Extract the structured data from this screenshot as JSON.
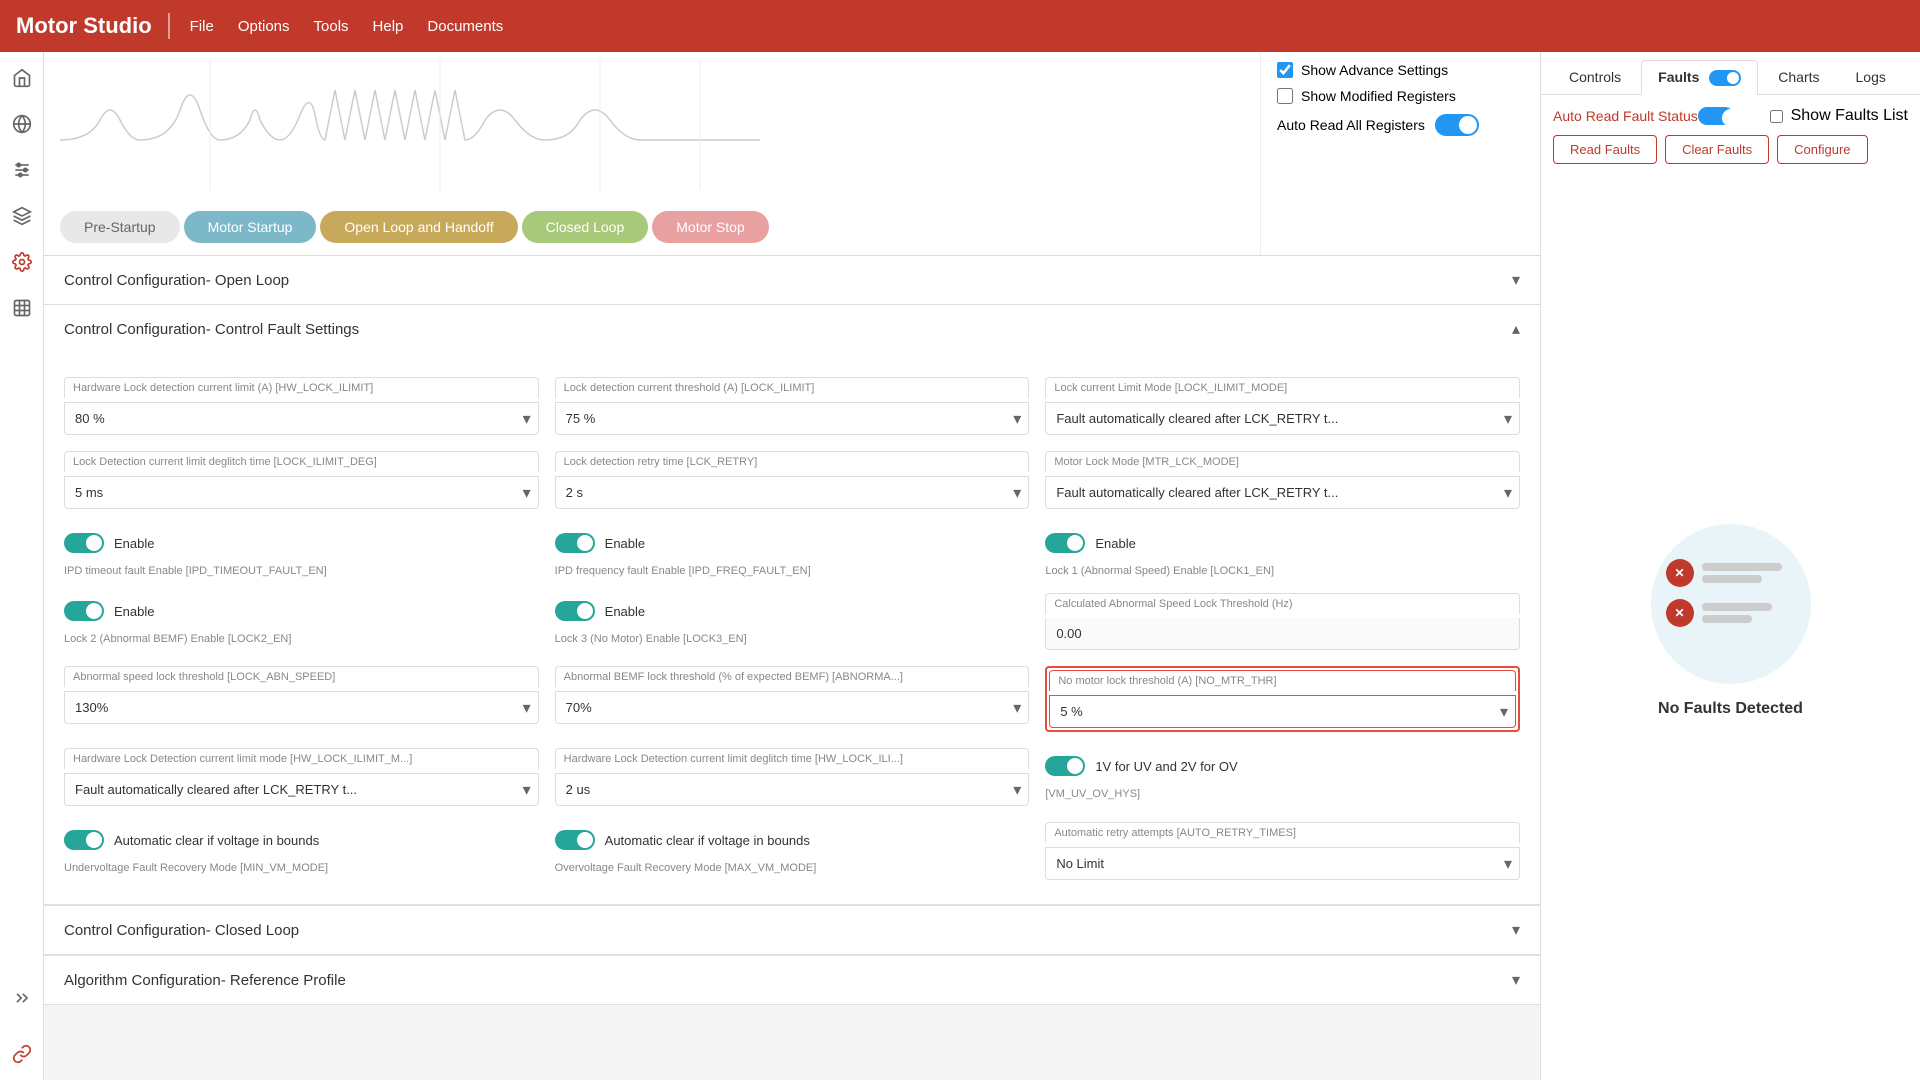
{
  "app": {
    "title": "Motor Studio",
    "menu": [
      "File",
      "Options",
      "Tools",
      "Help",
      "Documents"
    ]
  },
  "sidebar": {
    "icons": [
      "home",
      "globe",
      "sliders",
      "layers",
      "gear",
      "table",
      "settings-gear",
      "chevrons-right",
      "link"
    ]
  },
  "pipeline": {
    "steps": [
      {
        "label": "Pre-Startup",
        "class": "step-prestartup"
      },
      {
        "label": "Motor Startup",
        "class": "step-motorstartup"
      },
      {
        "label": "Open Loop and Handoff",
        "class": "step-openloop"
      },
      {
        "label": "Closed Loop",
        "class": "step-closedloop"
      },
      {
        "label": "Motor Stop",
        "class": "step-motorstop"
      }
    ]
  },
  "right_controls": {
    "show_advance_settings": {
      "label": "Show Advance Settings",
      "checked": true
    },
    "show_modified_registers": {
      "label": "Show Modified Registers",
      "checked": false
    },
    "auto_read_all_registers": {
      "label": "Auto Read All Registers",
      "on": true
    }
  },
  "faults_panel": {
    "tabs": [
      "Controls",
      "Faults",
      "Charts",
      "Logs"
    ],
    "active_tab": "Controls",
    "faults_tab_on": true,
    "auto_read_label": "Auto Read Fault Status",
    "auto_read_on": true,
    "show_faults_list": "Show Faults List",
    "buttons": [
      "Read Faults",
      "Clear Faults",
      "Configure"
    ],
    "no_faults_text": "No Faults Detected"
  },
  "sections": [
    {
      "title": "Control Configuration- Open Loop",
      "expanded": false
    },
    {
      "title": "Control Configuration- Control Fault Settings",
      "expanded": true
    },
    {
      "title": "Control Configuration- Closed Loop",
      "expanded": false
    },
    {
      "title": "Algorithm Configuration- Reference Profile",
      "expanded": false
    }
  ],
  "fault_settings": {
    "row1": [
      {
        "label": "Hardware Lock detection current limit (A) [HW_LOCK_ILIMIT]",
        "value": "80 %",
        "type": "select"
      },
      {
        "label": "Lock detection current threshold (A) [LOCK_ILIMIT]",
        "value": "75 %",
        "type": "select"
      },
      {
        "label": "Lock current Limit Mode [LOCK_ILIMIT_MODE]",
        "value": "Fault automatically cleared after LCK_RETRY t...",
        "type": "select"
      }
    ],
    "row2": [
      {
        "label": "Lock Detection current limit deglitch time [LOCK_ILIMIT_DEG]",
        "value": "5 ms",
        "type": "select"
      },
      {
        "label": "Lock detection retry time [LCK_RETRY]",
        "value": "2 s",
        "type": "select"
      },
      {
        "label": "Motor Lock Mode [MTR_LCK_MODE]",
        "value": "Fault automatically cleared after LCK_RETRY t...",
        "type": "select"
      }
    ],
    "row3": [
      {
        "label": "IPD timeout fault Enable [IPD_TIMEOUT_FAULT_EN]",
        "toggle": true,
        "toggle_label": "Enable"
      },
      {
        "label": "IPD frequency fault Enable [IPD_FREQ_FAULT_EN]",
        "toggle": true,
        "toggle_label": "Enable"
      },
      {
        "label": "Lock 1 (Abnormal Speed) Enable [LOCK1_EN]",
        "toggle": true,
        "toggle_label": "Enable"
      }
    ],
    "row4": [
      {
        "label": "Lock 2 (Abnormal BEMF) Enable [LOCK2_EN]",
        "toggle": true,
        "toggle_label": "Enable"
      },
      {
        "label": "Lock 3 (No Motor) Enable [LOCK3_EN]",
        "toggle": true,
        "toggle_label": "Enable"
      },
      {
        "label": "Calculated Abnormal Speed Lock Threshold (Hz)",
        "value": "0.00",
        "type": "readonly"
      }
    ],
    "row5": [
      {
        "label": "Abnormal speed lock threshold [LOCK_ABN_SPEED]",
        "value": "130%",
        "type": "select"
      },
      {
        "label": "Abnormal BEMF lock threshold (% of expected BEMF) [ABNORMA...]",
        "value": "70%",
        "type": "select"
      },
      {
        "label": "No motor lock threshold (A) [NO_MTR_THR]",
        "value": "5 %",
        "type": "select",
        "highlighted": true
      }
    ],
    "row6": [
      {
        "label": "Hardware Lock Detection current limit mode [HW_LOCK_ILIMIT_M...]",
        "value": "Fault automatically cleared after LCK_RETRY t...",
        "type": "select"
      },
      {
        "label": "Hardware Lock Detection current limit deglitch time [HW_LOCK_ILI...]",
        "value": "2 us",
        "type": "select"
      },
      {
        "label": "[VM_UV_OV_HYS]",
        "toggle": true,
        "toggle_label": "1V for UV and 2V for OV"
      }
    ],
    "row7": [
      {
        "label": "Undervoltage Fault Recovery Mode [MIN_VM_MODE]",
        "toggle": true,
        "toggle_label": "Automatic clear if voltage in bounds"
      },
      {
        "label": "Overvoltage Fault Recovery Mode [MAX_VM_MODE]",
        "toggle": true,
        "toggle_label": "Automatic clear if voltage in bounds"
      },
      {
        "label": "Automatic retry attempts [AUTO_RETRY_TIMES]",
        "value": "No Limit",
        "type": "select"
      }
    ]
  }
}
